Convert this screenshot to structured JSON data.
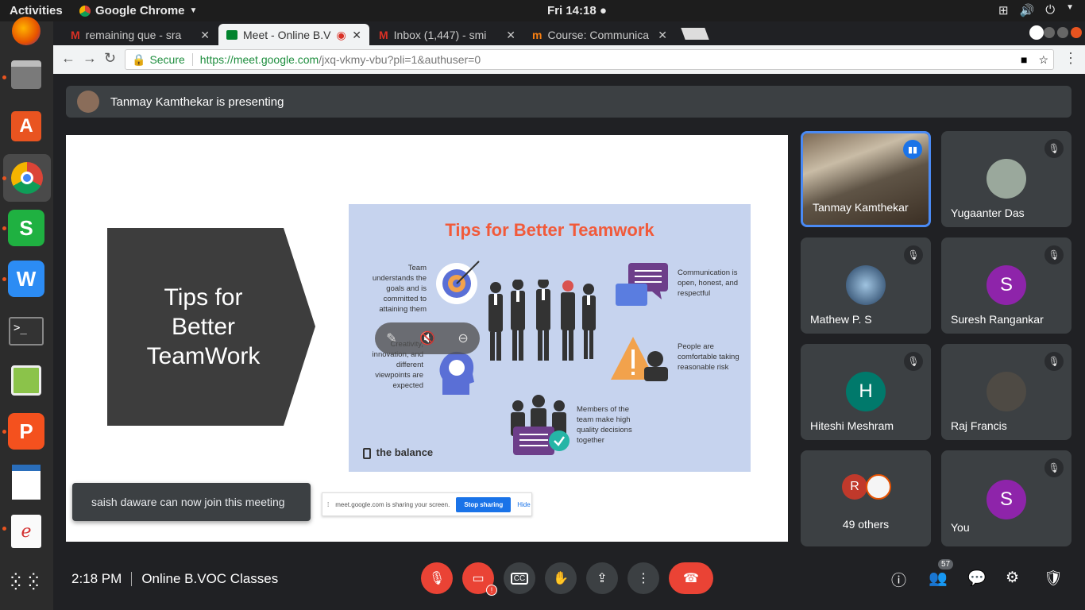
{
  "system_bar": {
    "activities": "Activities",
    "app_name": "Google Chrome",
    "clock": "Fri 14:18 ●"
  },
  "dock": {
    "icons": [
      "firefox-icon",
      "files-icon",
      "software-store-icon",
      "chrome-icon",
      "wps-spreadsheets-icon",
      "wps-writer-icon",
      "terminal-icon",
      "image-viewer-icon",
      "wps-presentation-icon",
      "libreoffice-writer-icon",
      "document-viewer-icon",
      "show-apps-icon"
    ]
  },
  "browser": {
    "tabs": [
      {
        "label": "remaining que - sra",
        "icon": "gmail-icon"
      },
      {
        "label": "Meet - Online B.V",
        "icon": "meet-icon"
      },
      {
        "label": "Inbox (1,447) - smi",
        "icon": "gmail-icon"
      },
      {
        "label": "Course: Communica",
        "icon": "moodle-icon"
      }
    ],
    "secure_label": "Secure",
    "url_host": "https://meet.google.com",
    "url_path": "/jxq-vkmy-vbu?pli=1&authuser=0"
  },
  "meet": {
    "presenting_text": "Tanmay Kamthekar is presenting",
    "slide": {
      "heading_line1": "Tips for",
      "heading_line2": "Better",
      "heading_line3": "TeamWork",
      "info_title": "Tips for Better Teamwork",
      "tip_goals": "Team understands the goals and is committed to attaining them",
      "tip_creativity": "Creativity, innovation, and different viewpoints are expected",
      "tip_communication": "Communication is open, honest, and respectful",
      "tip_risk": "People are comfortable taking reasonable risk",
      "tip_decisions": "Members of the team make high quality decisions together",
      "brand": "the balance"
    },
    "share_banner": {
      "text": "meet.google.com is sharing your screen.",
      "stop": "Stop sharing",
      "hide": "Hide"
    },
    "toast": "saish daware can now join this meeting",
    "participants": [
      {
        "name": "Tanmay Kamthekar"
      },
      {
        "name": "Yugaanter Das"
      },
      {
        "name": "Mathew P. S"
      },
      {
        "name": "Suresh Rangankar",
        "initial": "S",
        "color": "#8e24aa"
      },
      {
        "name": "Hiteshi Meshram",
        "initial": "H",
        "color": "#00796b"
      },
      {
        "name": "Raj Francis"
      },
      {
        "name": "49 others",
        "initial": "R",
        "color": "#c0392b"
      },
      {
        "name": "You",
        "initial": "S",
        "color": "#8e24aa"
      }
    ],
    "bottom": {
      "time": "2:18 PM",
      "meeting_name": "Online B.VOC Classes",
      "participant_count": "57"
    }
  }
}
